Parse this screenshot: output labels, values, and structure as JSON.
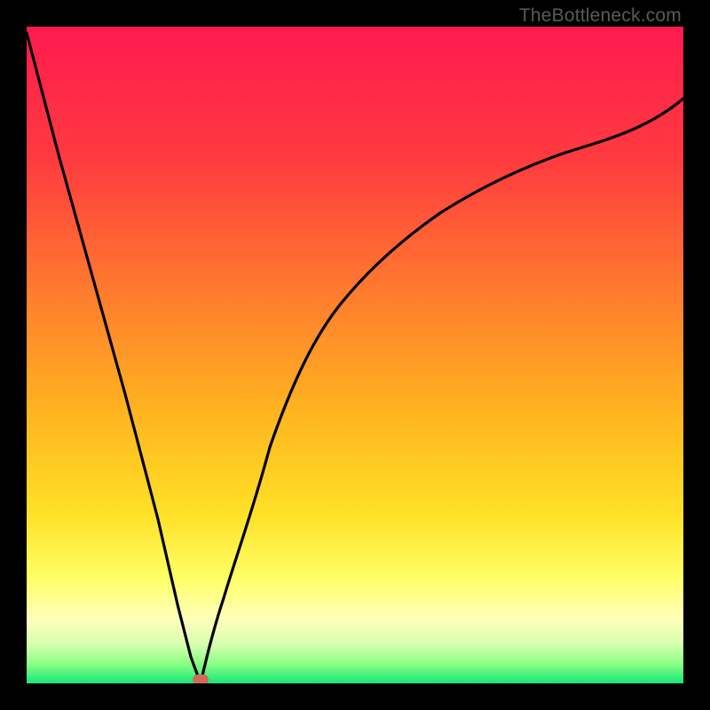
{
  "watermark": {
    "text": "TheBottleneck.com"
  },
  "colors": {
    "grad_top": "#ff1a4f",
    "grad_orange": "#ff7a2e",
    "grad_yellow": "#ffe026",
    "grad_paleyellow": "#ffffa4",
    "grad_lightgreen": "#9eff7c",
    "grad_green": "#17e67a",
    "curve": "#000000",
    "marker": "#cf6a57",
    "frame": "#000000"
  },
  "chart_data": {
    "type": "line",
    "title": "",
    "xlabel": "",
    "ylabel": "",
    "xlim": [
      0,
      100
    ],
    "ylim": [
      0,
      100
    ],
    "series": [
      {
        "name": "bottleneck-curve-left",
        "x": [
          0,
          5,
          10,
          15,
          20,
          23,
          25,
          26.5
        ],
        "values": [
          99,
          80,
          62,
          44,
          25,
          12,
          4,
          0
        ]
      },
      {
        "name": "bottleneck-curve-right",
        "x": [
          26.5,
          28,
          30,
          33,
          37,
          42,
          48,
          55,
          63,
          72,
          82,
          92,
          100
        ],
        "values": [
          0,
          5,
          13,
          24,
          36,
          48,
          58,
          67,
          74,
          80,
          84,
          87,
          89
        ]
      }
    ],
    "annotations": [
      {
        "name": "min-marker",
        "x": 26.5,
        "y": 0
      }
    ],
    "gradient_stops_pct": {
      "top_red": 0,
      "orange": 45,
      "yellow": 72,
      "pale_yellow": 87,
      "light_green": 95,
      "green": 100
    }
  }
}
